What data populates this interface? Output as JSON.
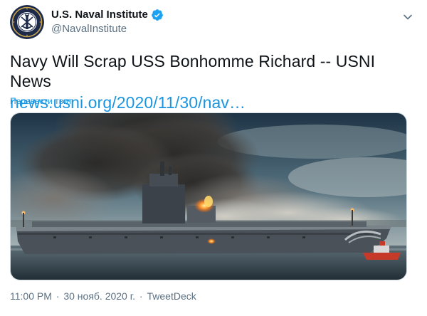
{
  "account": {
    "display_name": "U.S. Naval Institute",
    "handle": "@NavalInstitute",
    "verified": true
  },
  "tweet": {
    "text": "Navy Will Scrap USS Bonhomme Richard -- USNI News",
    "link": "news.usni.org/2020/11/30/nav…",
    "translate_label": "Перевести твит"
  },
  "meta": {
    "time": "11:00 PM",
    "separator": "·",
    "date": "30 нояб. 2020 г.",
    "source": "TweetDeck"
  },
  "colors": {
    "link_blue": "#1b95e0",
    "muted_gray": "#5b7083",
    "text_dark": "#0f1419",
    "avatar_navy": "#1d2a4a",
    "avatar_gold": "#c9a44a"
  },
  "icons": {
    "avatar": "naval-institute-seal-icon",
    "verified": "verified-badge-icon",
    "caret": "chevron-down-icon"
  }
}
